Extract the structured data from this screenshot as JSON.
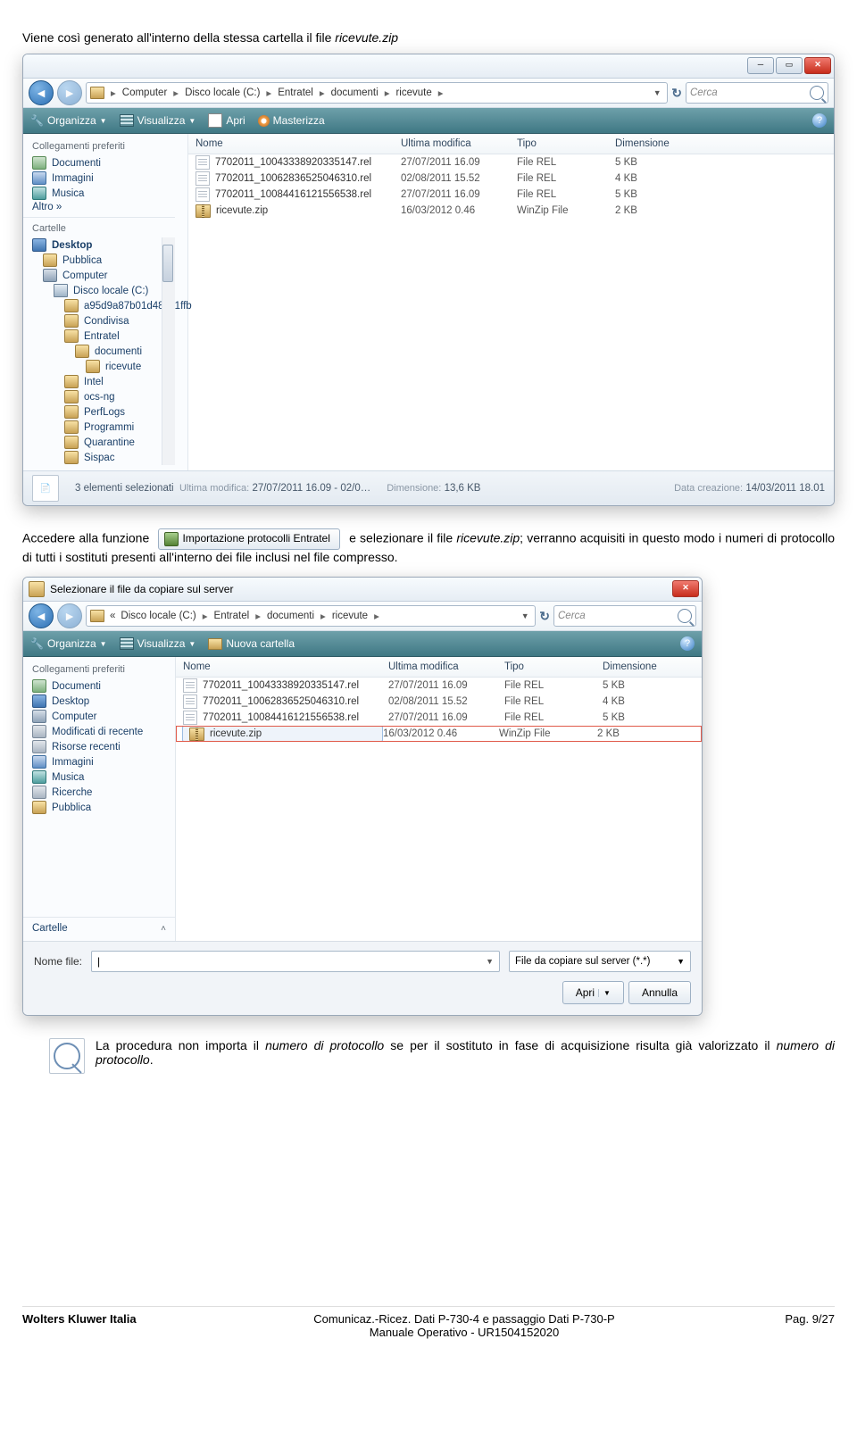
{
  "intro": {
    "prefix": "Viene così generato all'interno della stessa cartella il file ",
    "file": "ricevute.zip"
  },
  "explorer1": {
    "nav": {
      "crumbs": [
        "Computer",
        "Disco locale (C:)",
        "Entratel",
        "documenti",
        "ricevute"
      ],
      "search_placeholder": "Cerca"
    },
    "toolbar": {
      "organize": "Organizza",
      "views": "Visualizza",
      "open": "Apri",
      "burn": "Masterizza"
    },
    "side": {
      "fav_heading": "Collegamenti preferiti",
      "favs": [
        "Documenti",
        "Immagini",
        "Musica"
      ],
      "more": "Altro  »",
      "folders_heading": "Cartelle",
      "tree": {
        "desktop": "Desktop",
        "pubblica": "Pubblica",
        "computer": "Computer",
        "disk": "Disco locale (C:)",
        "folders": [
          "a95d9a87b01d481c1ffb",
          "Condivisa",
          "Entratel",
          "documenti",
          "ricevute",
          "Intel",
          "ocs-ng",
          "PerfLogs",
          "Programmi",
          "Quarantine",
          "Sispac"
        ]
      }
    },
    "columns": {
      "name": "Nome",
      "date": "Ultima modifica",
      "type": "Tipo",
      "size": "Dimensione"
    },
    "rows": [
      {
        "name": "7702011_10043338920335147.rel",
        "date": "27/07/2011 16.09",
        "type": "File REL",
        "size": "5 KB",
        "icon": "rel"
      },
      {
        "name": "7702011_10062836525046310.rel",
        "date": "02/08/2011 15.52",
        "type": "File REL",
        "size": "4 KB",
        "icon": "rel"
      },
      {
        "name": "7702011_10084416121556538.rel",
        "date": "27/07/2011 16.09",
        "type": "File REL",
        "size": "5 KB",
        "icon": "rel"
      },
      {
        "name": "ricevute.zip",
        "date": "16/03/2012 0.46",
        "type": "WinZip File",
        "size": "2 KB",
        "icon": "zip"
      }
    ],
    "status": {
      "sel": "3 elementi selezionati",
      "mod_lbl": "Ultima modifica:",
      "mod_val": "27/07/2011 16.09 - 02/0…",
      "dim_lbl": "Dimensione:",
      "dim_val": "13,6 KB",
      "crea_lbl": "Data creazione:",
      "crea_val": "14/03/2011 18.01"
    }
  },
  "mid_text": {
    "a": "Accedere alla funzione",
    "btn": "Importazione protocolli Entratel",
    "b": "e selezionare il file ",
    "file": "ricevute.zip",
    "c": "; verranno acquisiti in questo modo i numeri di protocollo di tutti i sostituti presenti all'interno dei file inclusi nel file compresso."
  },
  "explorer2": {
    "title": "Selezionare il file da copiare sul server",
    "nav": {
      "crumbs_prefix_label": "«",
      "crumbs": [
        "Disco locale (C:)",
        "Entratel",
        "documenti",
        "ricevute"
      ],
      "search_placeholder": "Cerca"
    },
    "toolbar": {
      "organize": "Organizza",
      "views": "Visualizza",
      "newfolder": "Nuova cartella"
    },
    "side": {
      "fav_heading": "Collegamenti preferiti",
      "items": [
        "Documenti",
        "Desktop",
        "Computer",
        "Modificati di recente",
        "Risorse recenti",
        "Immagini",
        "Musica",
        "Ricerche",
        "Pubblica"
      ],
      "folders_heading": "Cartelle"
    },
    "columns": {
      "name": "Nome",
      "date": "Ultima modifica",
      "type": "Tipo",
      "size": "Dimensione"
    },
    "rows": [
      {
        "name": "7702011_10043338920335147.rel",
        "date": "27/07/2011 16.09",
        "type": "File REL",
        "size": "5 KB",
        "icon": "rel"
      },
      {
        "name": "7702011_10062836525046310.rel",
        "date": "02/08/2011 15.52",
        "type": "File REL",
        "size": "4 KB",
        "icon": "rel"
      },
      {
        "name": "7702011_10084416121556538.rel",
        "date": "27/07/2011 16.09",
        "type": "File REL",
        "size": "5 KB",
        "icon": "rel"
      },
      {
        "name": "ricevute.zip",
        "date": "16/03/2012 0.46",
        "type": "WinZip File",
        "size": "2 KB",
        "icon": "zip",
        "hl": true
      }
    ],
    "bottom": {
      "label": "Nome file:",
      "value": "",
      "filter": "File da copiare sul server (*.*)",
      "open": "Apri",
      "cancel": "Annulla"
    }
  },
  "note": {
    "a": "La procedura non importa il ",
    "i1": "numero di protocollo",
    "b": " se per il sostituto in fase di acquisizione risulta già valorizzato il ",
    "i2": "numero di protocollo",
    "c": "."
  },
  "footer": {
    "left": "Wolters Kluwer Italia",
    "center1": "Comunicaz.-Ricez. Dati P-730-4 e passaggio Dati P-730-P",
    "center2": "Manuale Operativo - UR1504152020",
    "right": "Pag.  9/27"
  }
}
